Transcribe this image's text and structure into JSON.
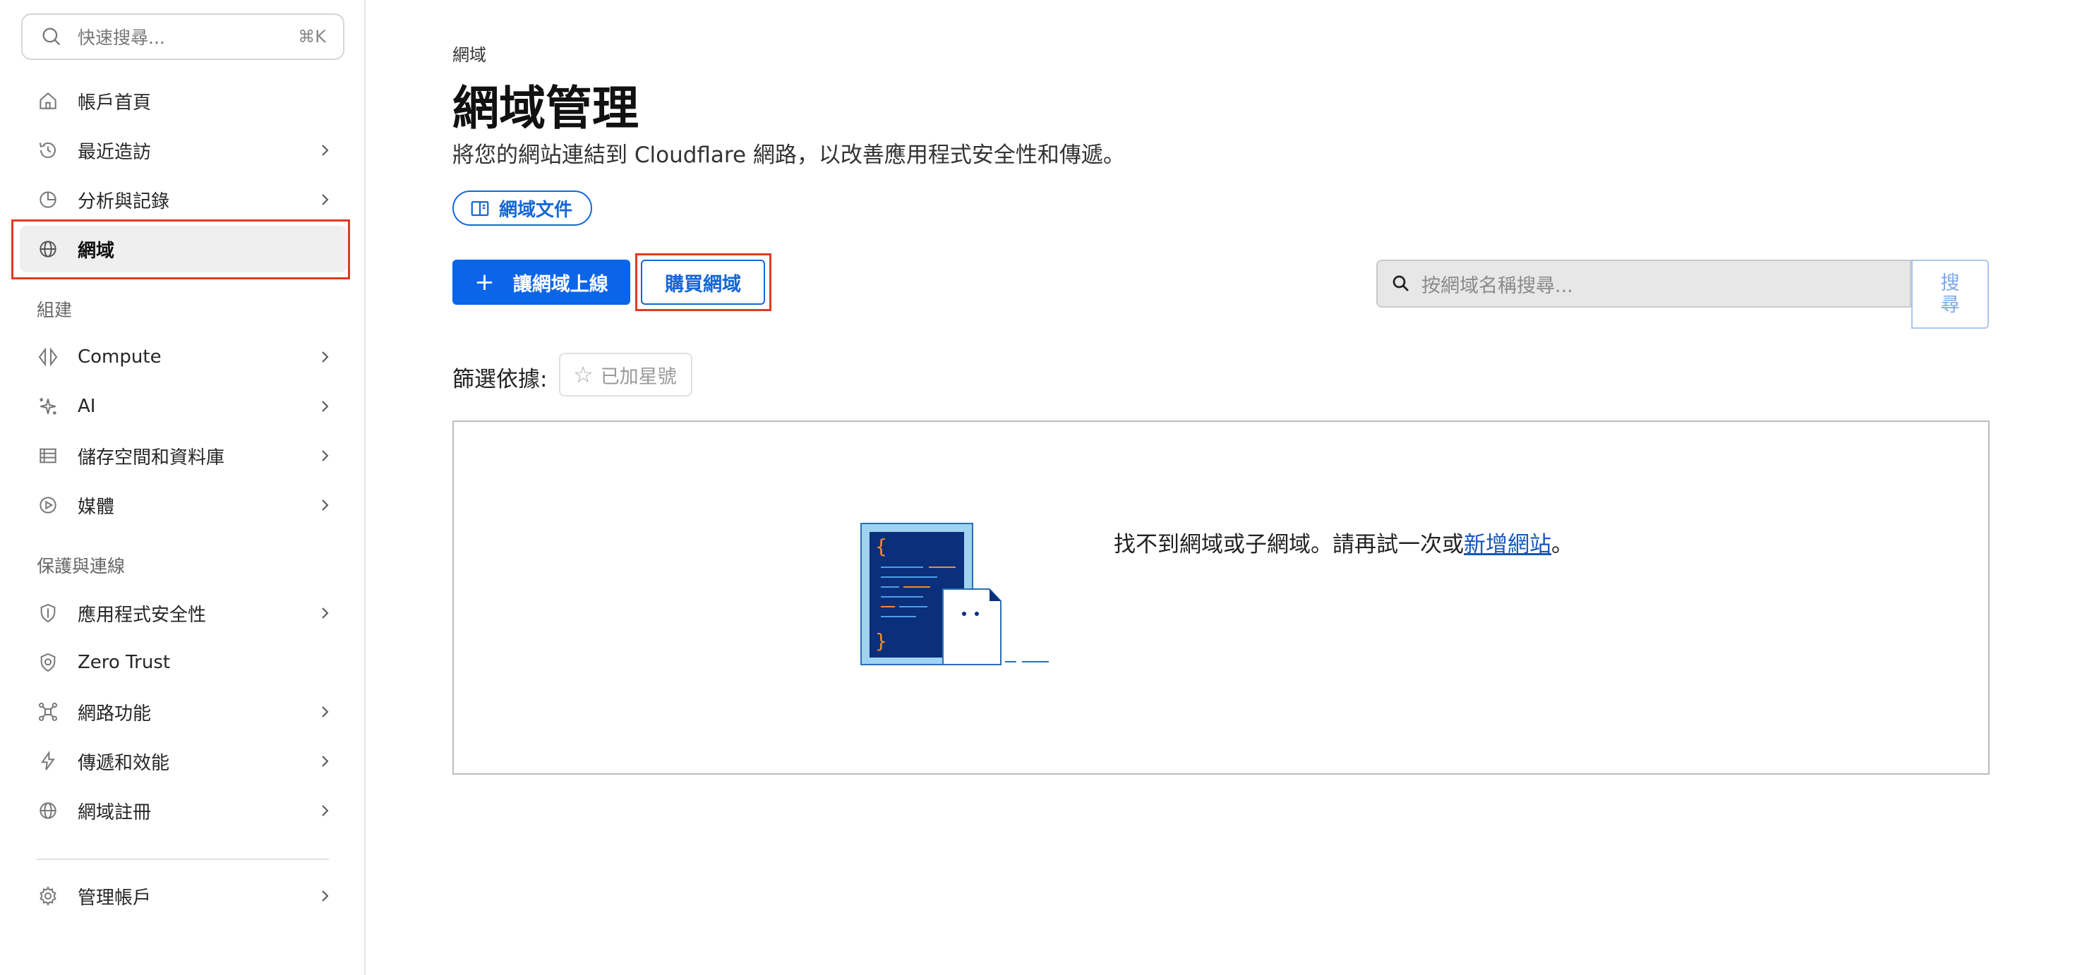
{
  "sidebar": {
    "search": {
      "placeholder": "快速搜尋...",
      "shortcut": "⌘K"
    },
    "items": [
      {
        "id": "account-home",
        "label": "帳戶首頁",
        "icon": "home-icon",
        "chevron": false
      },
      {
        "id": "recent",
        "label": "最近造訪",
        "icon": "history-icon",
        "chevron": true
      },
      {
        "id": "analytics",
        "label": "分析與記錄",
        "icon": "pie-chart-icon",
        "chevron": true
      },
      {
        "id": "domains",
        "label": "網域",
        "icon": "globe-icon",
        "chevron": false,
        "active": true
      }
    ],
    "section_build": "組建",
    "build_items": [
      {
        "id": "compute",
        "label": "Compute",
        "icon": "compute-icon",
        "chevron": true
      },
      {
        "id": "ai",
        "label": "AI",
        "icon": "sparkle-icon",
        "chevron": true
      },
      {
        "id": "storage",
        "label": "儲存空間和資料庫",
        "icon": "database-icon",
        "chevron": true
      },
      {
        "id": "media",
        "label": "媒體",
        "icon": "play-icon",
        "chevron": true
      }
    ],
    "section_protect": "保護與連線",
    "protect_items": [
      {
        "id": "app-security",
        "label": "應用程式安全性",
        "icon": "shield-icon",
        "chevron": true
      },
      {
        "id": "zero-trust",
        "label": "Zero Trust",
        "icon": "zero-trust-icon",
        "chevron": false
      },
      {
        "id": "network",
        "label": "網路功能",
        "icon": "network-icon",
        "chevron": true
      },
      {
        "id": "delivery",
        "label": "傳遞和效能",
        "icon": "bolt-icon",
        "chevron": true
      },
      {
        "id": "registrar",
        "label": "網域註冊",
        "icon": "globe-icon",
        "chevron": true
      }
    ],
    "manage_account": {
      "label": "管理帳戶",
      "icon": "gear-icon"
    }
  },
  "main": {
    "breadcrumb": "網域",
    "title": "網域管理",
    "description": "將您的網站連結到 Cloudflare 網路，以改善應用程式安全性和傳遞。",
    "docs_button": "網域文件",
    "onboard_button": "讓網域上線",
    "onboard_plus": "+",
    "buy_button": "購買網域",
    "domain_search": {
      "placeholder": "按網域名稱搜尋...",
      "submit_line1": "搜",
      "submit_line2": "尋"
    },
    "filter_label": "篩選依據:",
    "starred_chip": "已加星號",
    "starred_icon": "☆",
    "empty": {
      "message": "找不到網域或子網域。請再試一次或",
      "link": "新增網站",
      "suffix": "。"
    }
  },
  "colors": {
    "accent": "#0b65e8",
    "link": "#1467d6",
    "highlight": "#e03a22"
  }
}
